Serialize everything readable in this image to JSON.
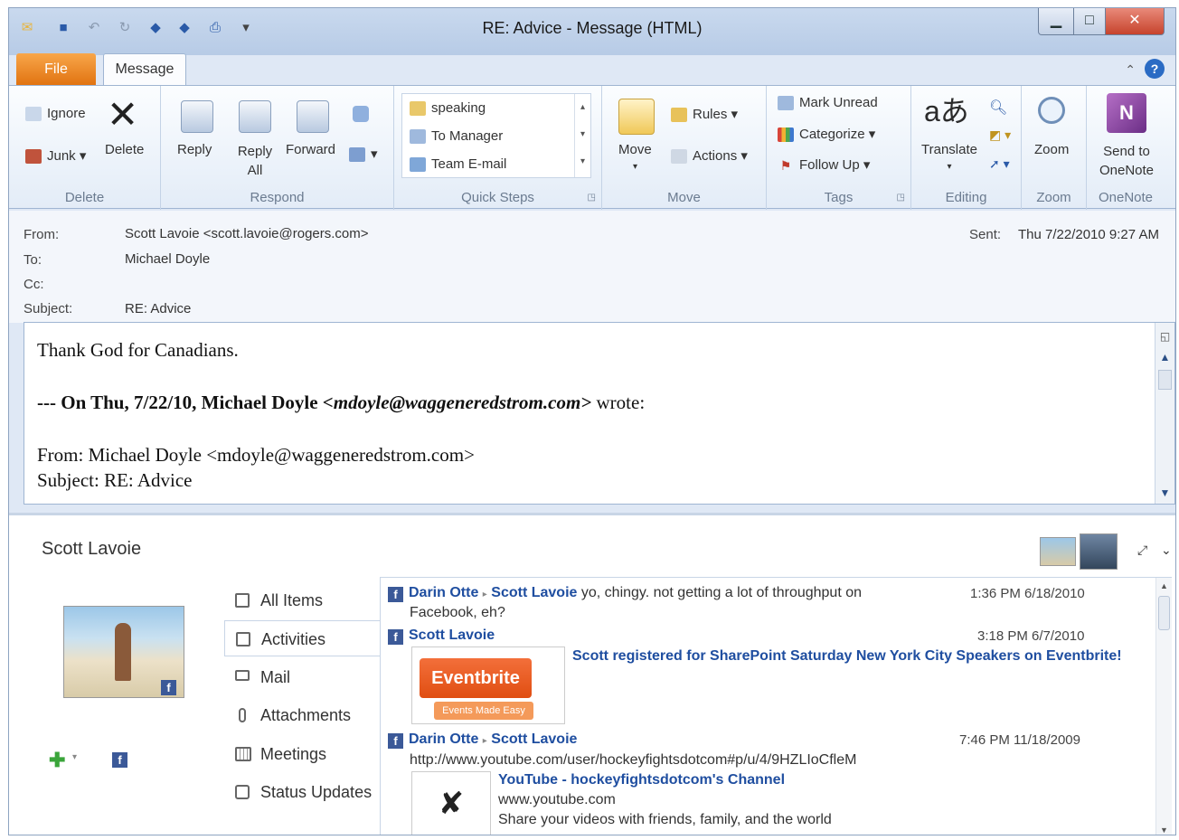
{
  "window": {
    "title": "RE: Advice - Message (HTML)"
  },
  "tabs": {
    "file": "File",
    "message": "Message"
  },
  "ribbon": {
    "delete_group": {
      "label": "Delete",
      "ignore": "Ignore",
      "junk": "Junk",
      "delete": "Delete"
    },
    "respond_group": {
      "label": "Respond",
      "reply": "Reply",
      "reply_all": "Reply All",
      "forward": "Forward"
    },
    "quick_steps": {
      "label": "Quick Steps",
      "items": [
        "speaking",
        "To Manager",
        "Team E-mail"
      ]
    },
    "move_group": {
      "label": "Move",
      "move": "Move",
      "rules": "Rules",
      "actions": "Actions"
    },
    "tags_group": {
      "label": "Tags",
      "mark_unread": "Mark Unread",
      "categorize": "Categorize",
      "follow_up": "Follow Up"
    },
    "editing_group": {
      "label": "Editing",
      "translate": "Translate"
    },
    "zoom_group": {
      "label": "Zoom",
      "zoom": "Zoom"
    },
    "onenote_group": {
      "label": "OneNote",
      "send": "Send to OneNote"
    }
  },
  "header": {
    "from_label": "From:",
    "from": "Scott Lavoie <scott.lavoie@rogers.com>",
    "to_label": "To:",
    "to": "Michael Doyle",
    "cc_label": "Cc:",
    "subject_label": "Subject:",
    "subject": "RE: Advice",
    "sent_label": "Sent:",
    "sent": "Thu 7/22/2010 9:27 AM"
  },
  "body": {
    "line1": "Thank God for Canadians.",
    "q_prefix": "--- On ",
    "q_date": "Thu, 7/22/10, Michael Doyle ",
    "q_email": "<mdoyle@waggeneredstrom.com>",
    "q_suffix": " wrote:",
    "from_line": "From: Michael Doyle <mdoyle@waggeneredstrom.com>",
    "subject_line": "Subject: RE: Advice"
  },
  "people": {
    "name": "Scott Lavoie",
    "nav": [
      "All Items",
      "Activities",
      "Mail",
      "Attachments",
      "Meetings",
      "Status Updates"
    ],
    "feed": [
      {
        "from": "Darin Otte",
        "to": "Scott Lavoie",
        "text": "yo, chingy. not getting a lot of throughput on",
        "text2": "Facebook, eh?",
        "time": "1:36 PM 6/18/2010"
      },
      {
        "from": "Scott Lavoie",
        "time": "3:18 PM 6/7/2010",
        "headline": "Scott registered for SharePoint Saturday New York City Speakers on Eventbrite!",
        "logo": "Eventbrite",
        "logo_sub": "Events Made Easy"
      },
      {
        "from": "Darin Otte",
        "to": "Scott Lavoie",
        "time": "7:46 PM 11/18/2009",
        "url": "http://www.youtube.com/user/hockeyfightsdotcom#p/u/4/9HZLIoCfleM",
        "link_title": "YouTube - hockeyfightsdotcom's Channel",
        "site": "www.youtube.com",
        "desc": "Share your videos with friends, family, and the world"
      }
    ]
  },
  "colors": {
    "file_tab": "#e0720f",
    "link": "#1f4ea0",
    "facebook": "#3b5998"
  }
}
